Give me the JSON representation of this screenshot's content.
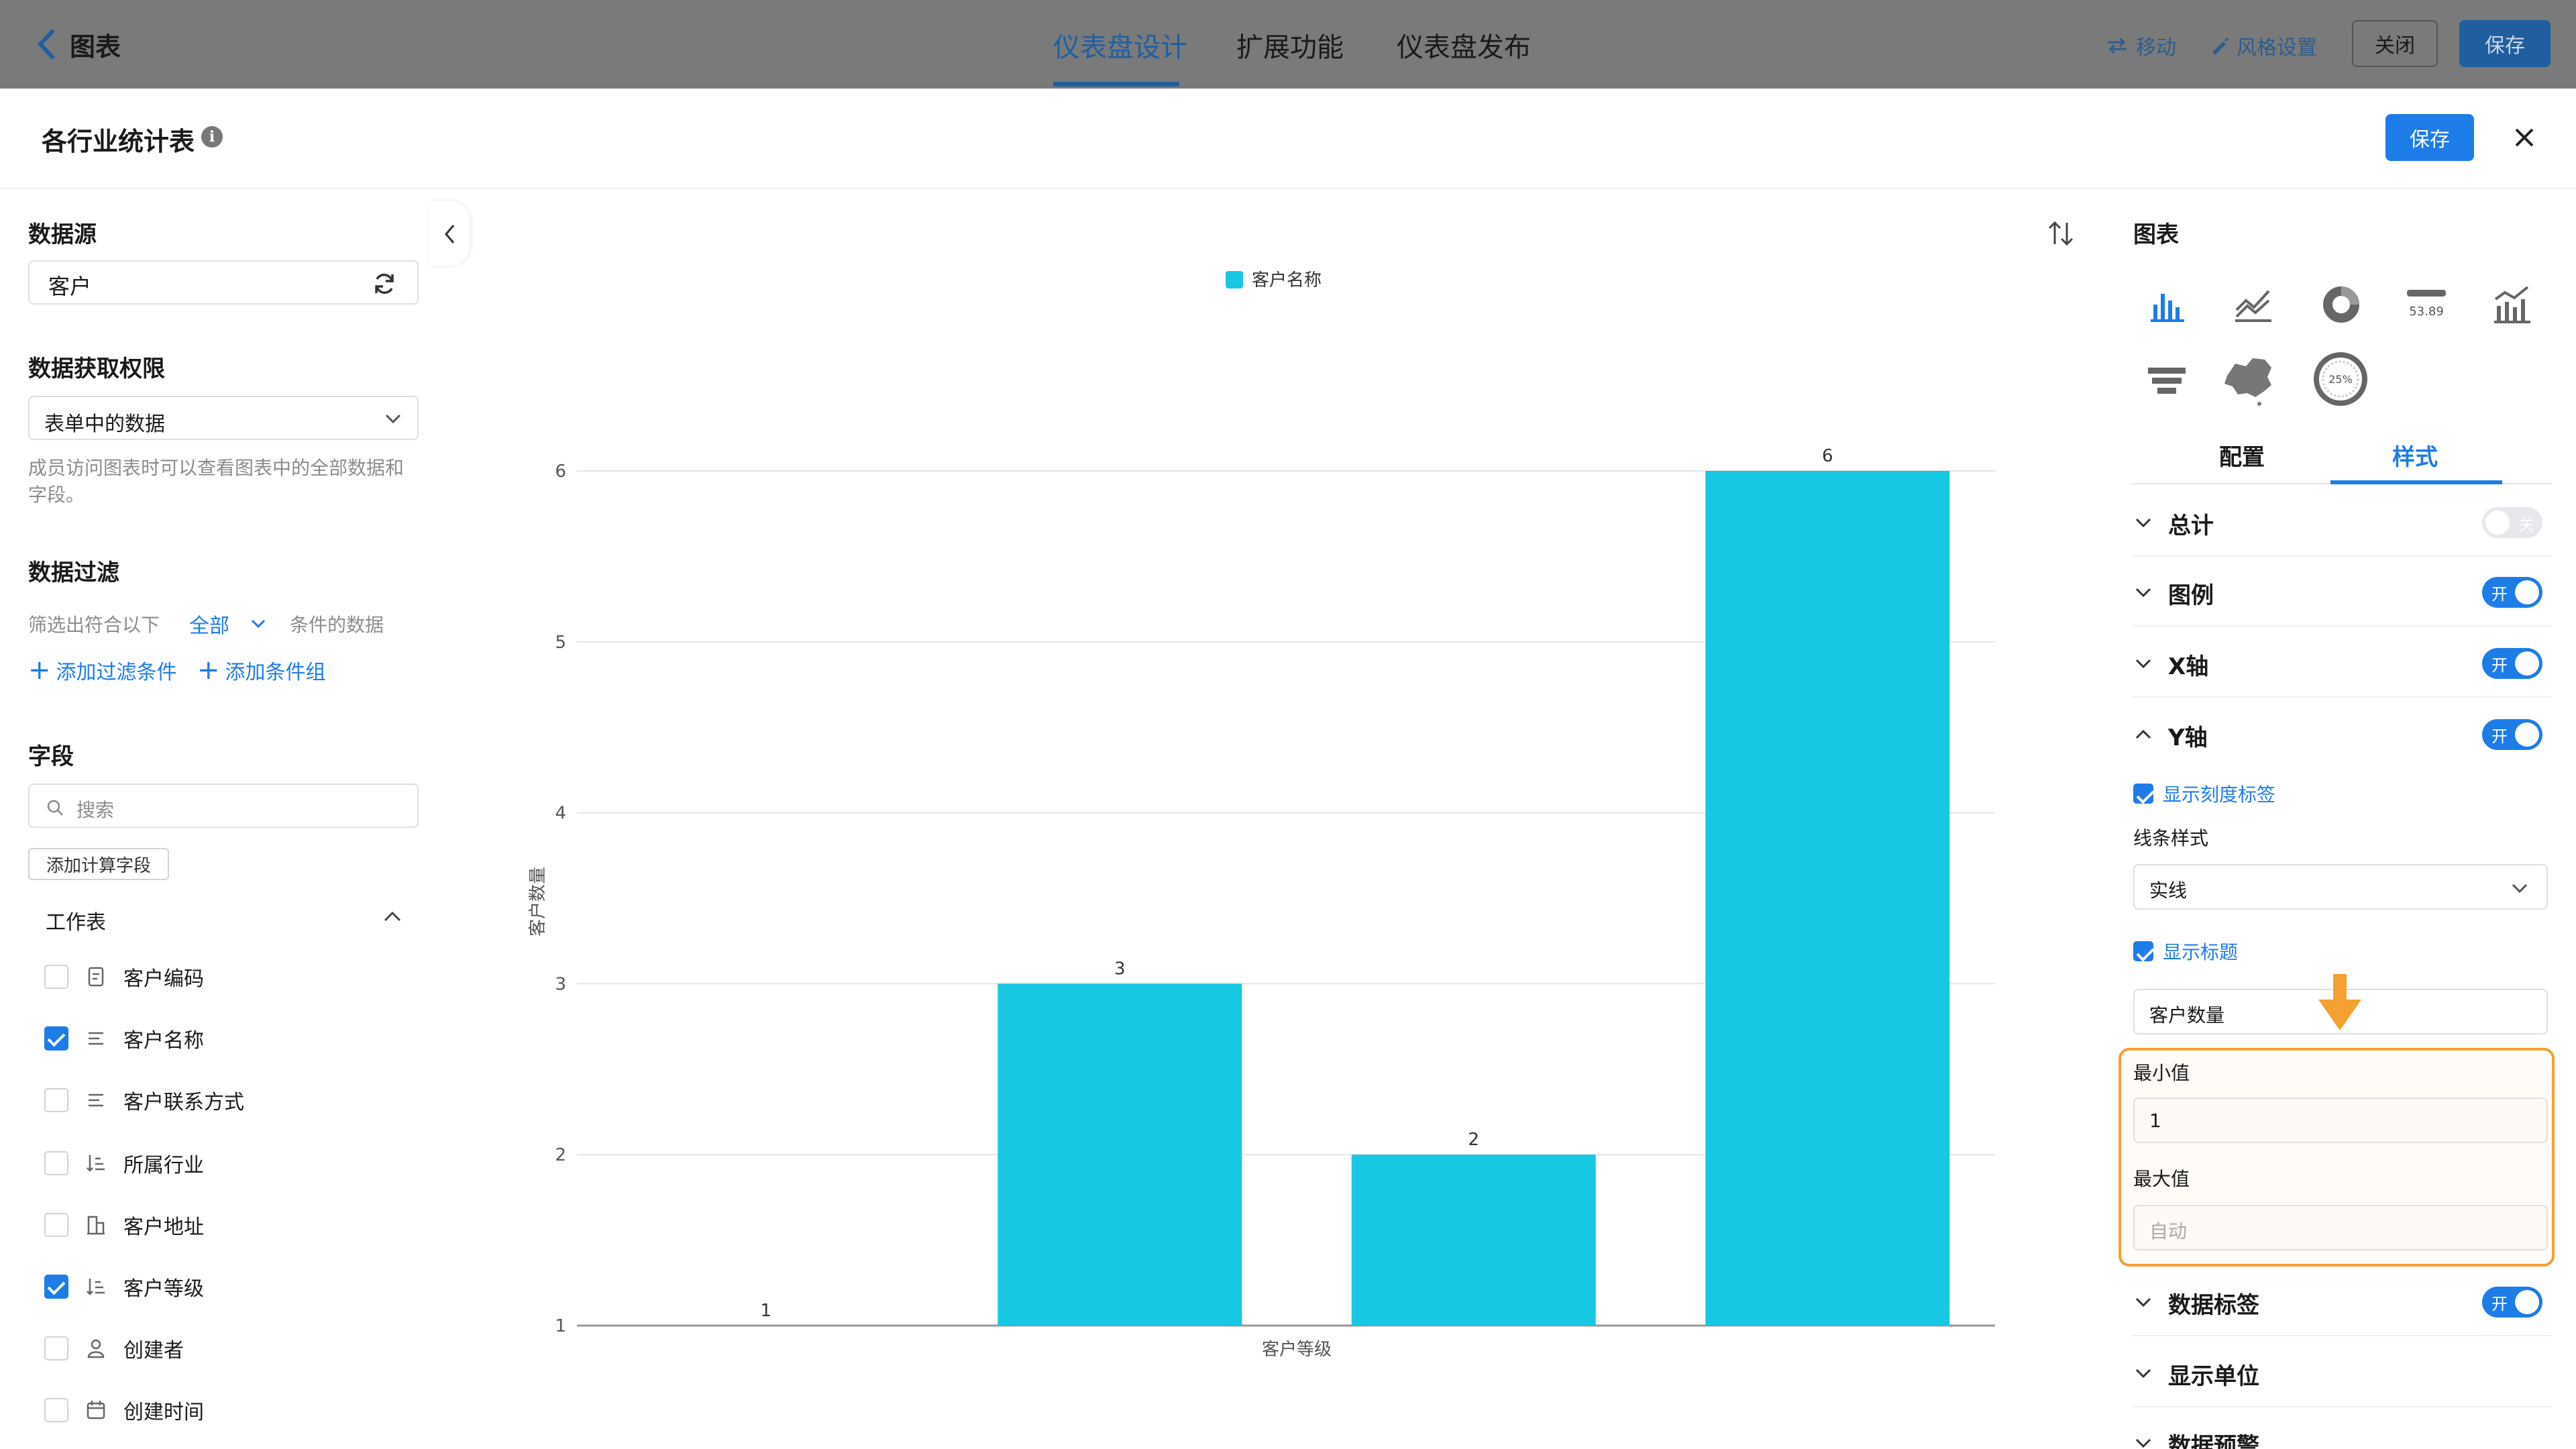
{
  "topbar": {
    "back_label": "图表",
    "tabs": [
      "仪表盘设计",
      "扩展功能",
      "仪表盘发布"
    ],
    "active_tab": "仪表盘设计",
    "move_label": "移动",
    "style_label": "风格设置",
    "close_label": "关闭",
    "save_label": "保存"
  },
  "modal": {
    "title": "各行业统计表",
    "save_label": "保存"
  },
  "left": {
    "datasource_title": "数据源",
    "datasource_value": "客户",
    "permission_title": "数据获取权限",
    "permission_value": "表单中的数据",
    "permission_hint": "成员访问图表时可以查看图表中的全部数据和字段。",
    "filter_title": "数据过滤",
    "filter_prefix": "筛选出符合以下",
    "filter_scope": "全部",
    "filter_suffix": "条件的数据",
    "add_filter": "添加过滤条件",
    "add_group": "添加条件组",
    "fields_title": "字段",
    "search_placeholder": "搜索",
    "add_calc_field": "添加计算字段",
    "worksheet_label": "工作表",
    "fields": [
      {
        "name": "客户编码",
        "icon": "doc-icon",
        "checked": false
      },
      {
        "name": "客户名称",
        "icon": "text-icon",
        "checked": true
      },
      {
        "name": "客户联系方式",
        "icon": "text-icon",
        "checked": false
      },
      {
        "name": "所属行业",
        "icon": "sort-list-icon",
        "checked": false
      },
      {
        "name": "客户地址",
        "icon": "building-icon",
        "checked": false
      },
      {
        "name": "客户等级",
        "icon": "sort-list-icon",
        "checked": true
      },
      {
        "name": "创建者",
        "icon": "user-icon",
        "checked": false
      },
      {
        "name": "创建时间",
        "icon": "calendar-icon",
        "checked": false
      }
    ]
  },
  "chart_data": {
    "type": "bar",
    "legend": [
      "客户名称"
    ],
    "legend_position": "top-center",
    "xlabel": "客户等级",
    "ylabel": "客户数量",
    "ylim": [
      1,
      6
    ],
    "yticks": [
      "1",
      "2",
      "3",
      "4",
      "5",
      "6"
    ],
    "series": [
      {
        "name": "客户名称",
        "values": [
          1,
          3,
          2,
          6
        ]
      }
    ],
    "data_labels": [
      "1",
      "3",
      "2",
      "6"
    ],
    "color": "#17c8e3",
    "grid": true
  },
  "right": {
    "chart_title": "图表",
    "gauge_value_label": "53.89",
    "ring_label": "25%",
    "tab_config": "配置",
    "tab_style": "样式",
    "active_tab": "样式",
    "sections": {
      "total": {
        "label": "总计",
        "toggle": "关",
        "on": false
      },
      "legend": {
        "label": "图例",
        "toggle": "开",
        "on": true
      },
      "xaxis": {
        "label": "X轴",
        "toggle": "开",
        "on": true
      },
      "yaxis": {
        "label": "Y轴",
        "toggle": "开",
        "on": true
      },
      "datalabel": {
        "label": "数据标签",
        "toggle": "开",
        "on": true
      },
      "unit": {
        "label": "显示单位"
      },
      "warning": {
        "label": "数据预警"
      }
    },
    "y_show_tick_labels": "显示刻度标签",
    "y_line_style_label": "线条样式",
    "y_line_style_value": "实线",
    "y_show_title": "显示标题",
    "y_title_value": "客户数量",
    "y_min_label": "最小值",
    "y_min_value": "1",
    "y_max_label": "最大值",
    "y_max_placeholder": "自动",
    "highlight_color": "#f5a033"
  }
}
